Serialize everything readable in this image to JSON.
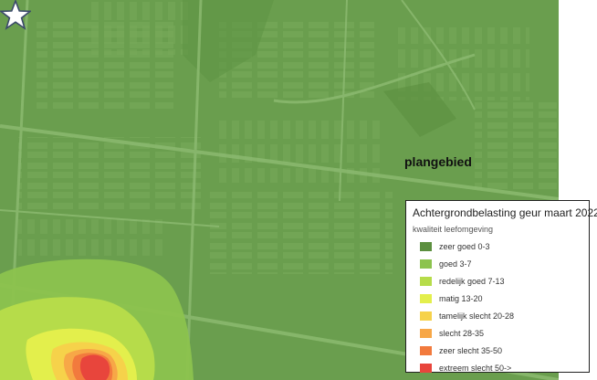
{
  "map": {
    "base_color": "#6a9e4e",
    "marker": {
      "icon": "star-icon",
      "label": "plangebied"
    }
  },
  "legend": {
    "title": "Achtergrondbelasting geur maart 2022",
    "subtitle": "kwaliteit leefomgeving",
    "items": [
      {
        "label": "zeer goed 0-3",
        "color": "#5c8f3f"
      },
      {
        "label": "goed 3-7",
        "color": "#8cc34e"
      },
      {
        "label": "redelijk goed 7-13",
        "color": "#b6dc4a"
      },
      {
        "label": "matig 13-20",
        "color": "#e3ef4c"
      },
      {
        "label": "tamelijk slecht 20-28",
        "color": "#f6d24a"
      },
      {
        "label": "slecht 28-35",
        "color": "#f7a747"
      },
      {
        "label": "zeer slecht 35-50",
        "color": "#f27a3d"
      },
      {
        "label": "extreem slecht 50->",
        "color": "#e8453c"
      }
    ]
  }
}
